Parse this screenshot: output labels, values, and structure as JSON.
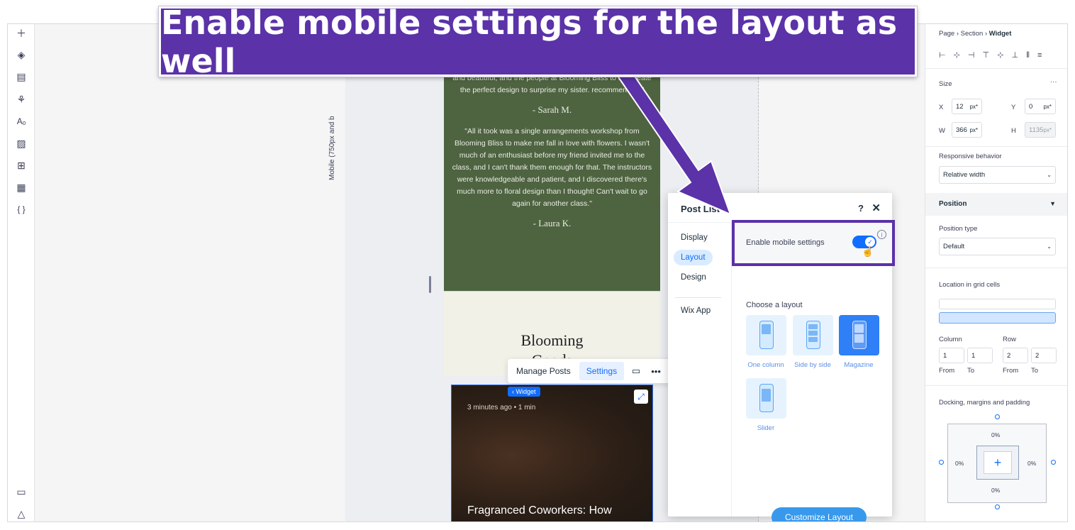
{
  "banner": {
    "text": "Enable mobile settings for the layout as well"
  },
  "toolbar": {
    "icons": [
      "plus-icon",
      "layers-icon",
      "pages-icon",
      "connections-icon",
      "text-theme-icon",
      "media-icon",
      "apps-icon",
      "table-icon",
      "code-icon",
      "chat-icon",
      "learn-icon"
    ]
  },
  "canvas": {
    "viewport_label": "Mobile (750px and b",
    "testimonials": [
      {
        "quote": "and beautiful, and the people at Blooming Bliss to me create the perfect design to surprise my sister. recommended.\"",
        "author": "- Sarah M."
      },
      {
        "quote": "\"All it took was a single arrangements workshop from Blooming Bliss to make me fall in love with flowers. I wasn't much of an enthusiast before my friend invited me to the class, and I can't thank them enough for that. The instructors were knowledgeable and patient, and I discovered there's much more to floral design than I thought! Can't wait to go again for another class.\"",
        "author": "- Laura K."
      }
    ],
    "brand_line1": "Blooming",
    "brand_line2": "Goods",
    "post_meta": "3 minutes ago  •  1 min",
    "post_title": "Fragranced Coworkers: How",
    "widget_tag": "‹ Widget"
  },
  "actionbar": {
    "manage": "Manage Posts",
    "settings": "Settings"
  },
  "panel": {
    "title": "Post List",
    "help": "?",
    "close": "✕",
    "nav": [
      "Display",
      "Layout",
      "Design",
      "Wix App"
    ],
    "mobile_settings_label": "Enable mobile settings",
    "mobile_settings_on": true,
    "choose_layout": "Choose a layout",
    "layouts": [
      "One column",
      "Side by side",
      "Magazine",
      "Slider"
    ],
    "selected_layout": "Magazine",
    "customize_button": "Customize Layout"
  },
  "inspector": {
    "breadcrumb": [
      "Page",
      "Section",
      "Widget"
    ],
    "size_label": "Size",
    "x_label": "X",
    "x_value": "12",
    "x_unit": "px*",
    "y_label": "Y",
    "y_value": "0",
    "y_unit": "px*",
    "w_label": "W",
    "w_value": "366",
    "w_unit": "px*",
    "h_label": "H",
    "h_value": "1135",
    "h_unit": "px*",
    "responsive_label": "Responsive behavior",
    "responsive_value": "Relative width",
    "position_header": "Position",
    "position_type_label": "Position type",
    "position_type_value": "Default",
    "grid_cells_label": "Location in grid cells",
    "column_label": "Column",
    "row_label": "Row",
    "col_from": "1",
    "col_to": "1",
    "row_from": "2",
    "row_to": "2",
    "from_label": "From",
    "to_label": "To",
    "docking_label": "Docking, margins and padding",
    "margin_top": "0%",
    "margin_left": "0%",
    "margin_right": "0%",
    "margin_bottom": "0%",
    "more": "···"
  }
}
